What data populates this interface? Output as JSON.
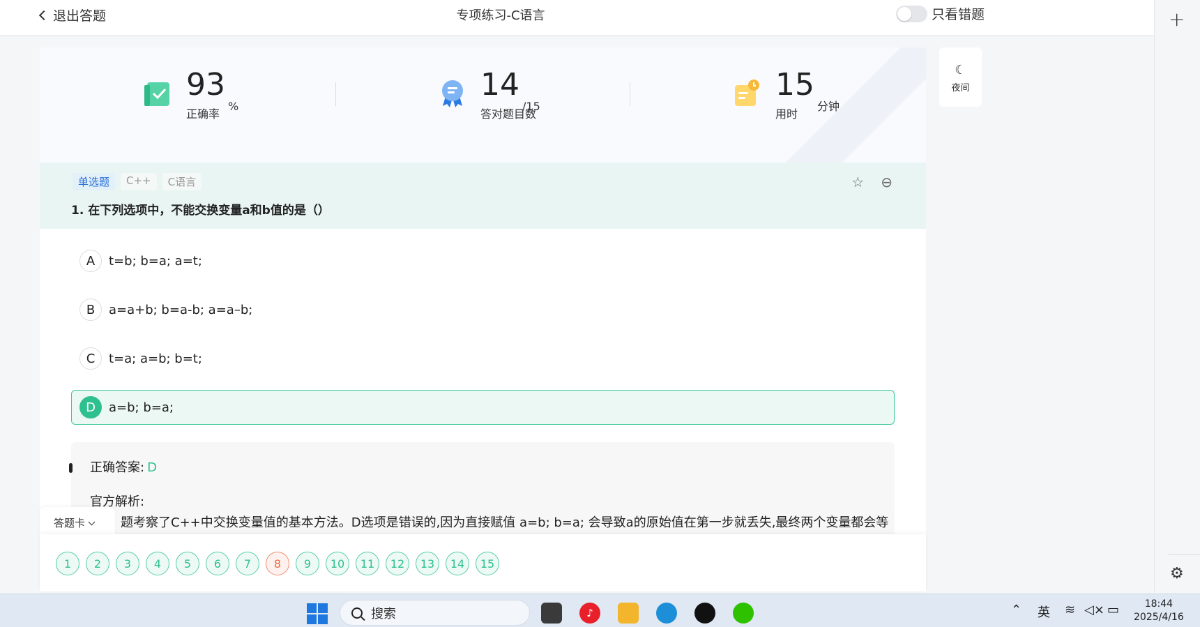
{
  "header": {
    "back_label": "退出答题",
    "title": "专项练习-C语言",
    "wrong_only_label": "只看错题"
  },
  "stats": {
    "accuracy": {
      "value": "93",
      "unit": "%",
      "label": "正确率"
    },
    "correct": {
      "value": "14",
      "unit": "/15",
      "label": "答对题目数"
    },
    "time": {
      "value": "15",
      "unit": "分钟",
      "label": "用时"
    }
  },
  "night_mode": {
    "label": "夜间",
    "icon": "moon-icon"
  },
  "question": {
    "tags": [
      "单选题",
      "C++",
      "C语言"
    ],
    "text": "1. 在下列选项中，不能交换变量a和b值的是（）",
    "options": [
      {
        "letter": "A",
        "text": "t=b; b=a; a=t;"
      },
      {
        "letter": "B",
        "text": "a=a+b; b=a-b; a=a–b;"
      },
      {
        "letter": "C",
        "text": "t=a; a=b; b=t;"
      },
      {
        "letter": "D",
        "text": "a=b; b=a;"
      }
    ],
    "selected": "D"
  },
  "answer": {
    "correct_label": "正确答案:",
    "correct_value": "D",
    "analysis_label": "官方解析:",
    "analysis_text": "题考察了C++中交换变量值的基本方法。D选项是错误的,因为直接赋值 a=b; b=a; 会导致a的原始值在第一步就丢失,最终两个变量都会等"
  },
  "answer_card": {
    "label": "答题卡",
    "numbers": [
      "1",
      "2",
      "3",
      "4",
      "5",
      "6",
      "7",
      "8",
      "9",
      "10",
      "11",
      "12",
      "13",
      "14",
      "15"
    ],
    "wrong": [
      "8"
    ]
  },
  "taskbar": {
    "search_placeholder": "搜索",
    "ime": "英",
    "time": "18:44",
    "date": "2025/4/16"
  },
  "colors": {
    "accent": "#2ec08e",
    "wrong": "#ea6a44",
    "question_bg": "#e8f5f2",
    "tag_primary": "#2a6fd6"
  }
}
